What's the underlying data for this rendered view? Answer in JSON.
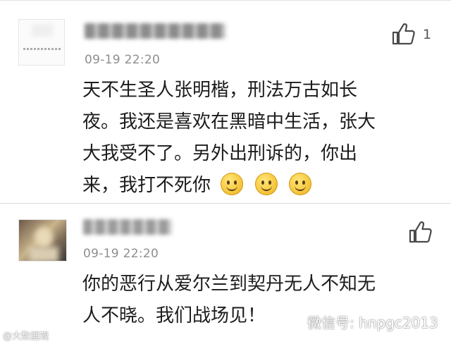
{
  "comments": [
    {
      "username": "blurred",
      "timestamp": "09-19 22:20",
      "like_count": "1",
      "lines": [
        "天不生圣人张明楷，刑法万古如长",
        "夜。我还是喜欢在黑暗中生活，张大",
        "大我受不了。另外出刑诉的，你出",
        "来，我打不死你"
      ],
      "emoji_count": 3
    },
    {
      "username": "blurred",
      "timestamp": "09-19 22:20",
      "like_count": "",
      "lines": [
        "你的恶行从爱尔兰到契丹无人不知无",
        "人不晓。我们战场见！"
      ]
    }
  ],
  "watermarks": {
    "left": "@大数据观",
    "right": "微信号: hnpgc2013"
  },
  "icons": {
    "like": "thumbs-up-icon",
    "emoji": "smiley-face-icon",
    "wechat": "wechat-icon"
  },
  "colors": {
    "text": "#1c1c1c",
    "timestamp": "#8e8e8e",
    "divider": "#dcdcdc"
  }
}
